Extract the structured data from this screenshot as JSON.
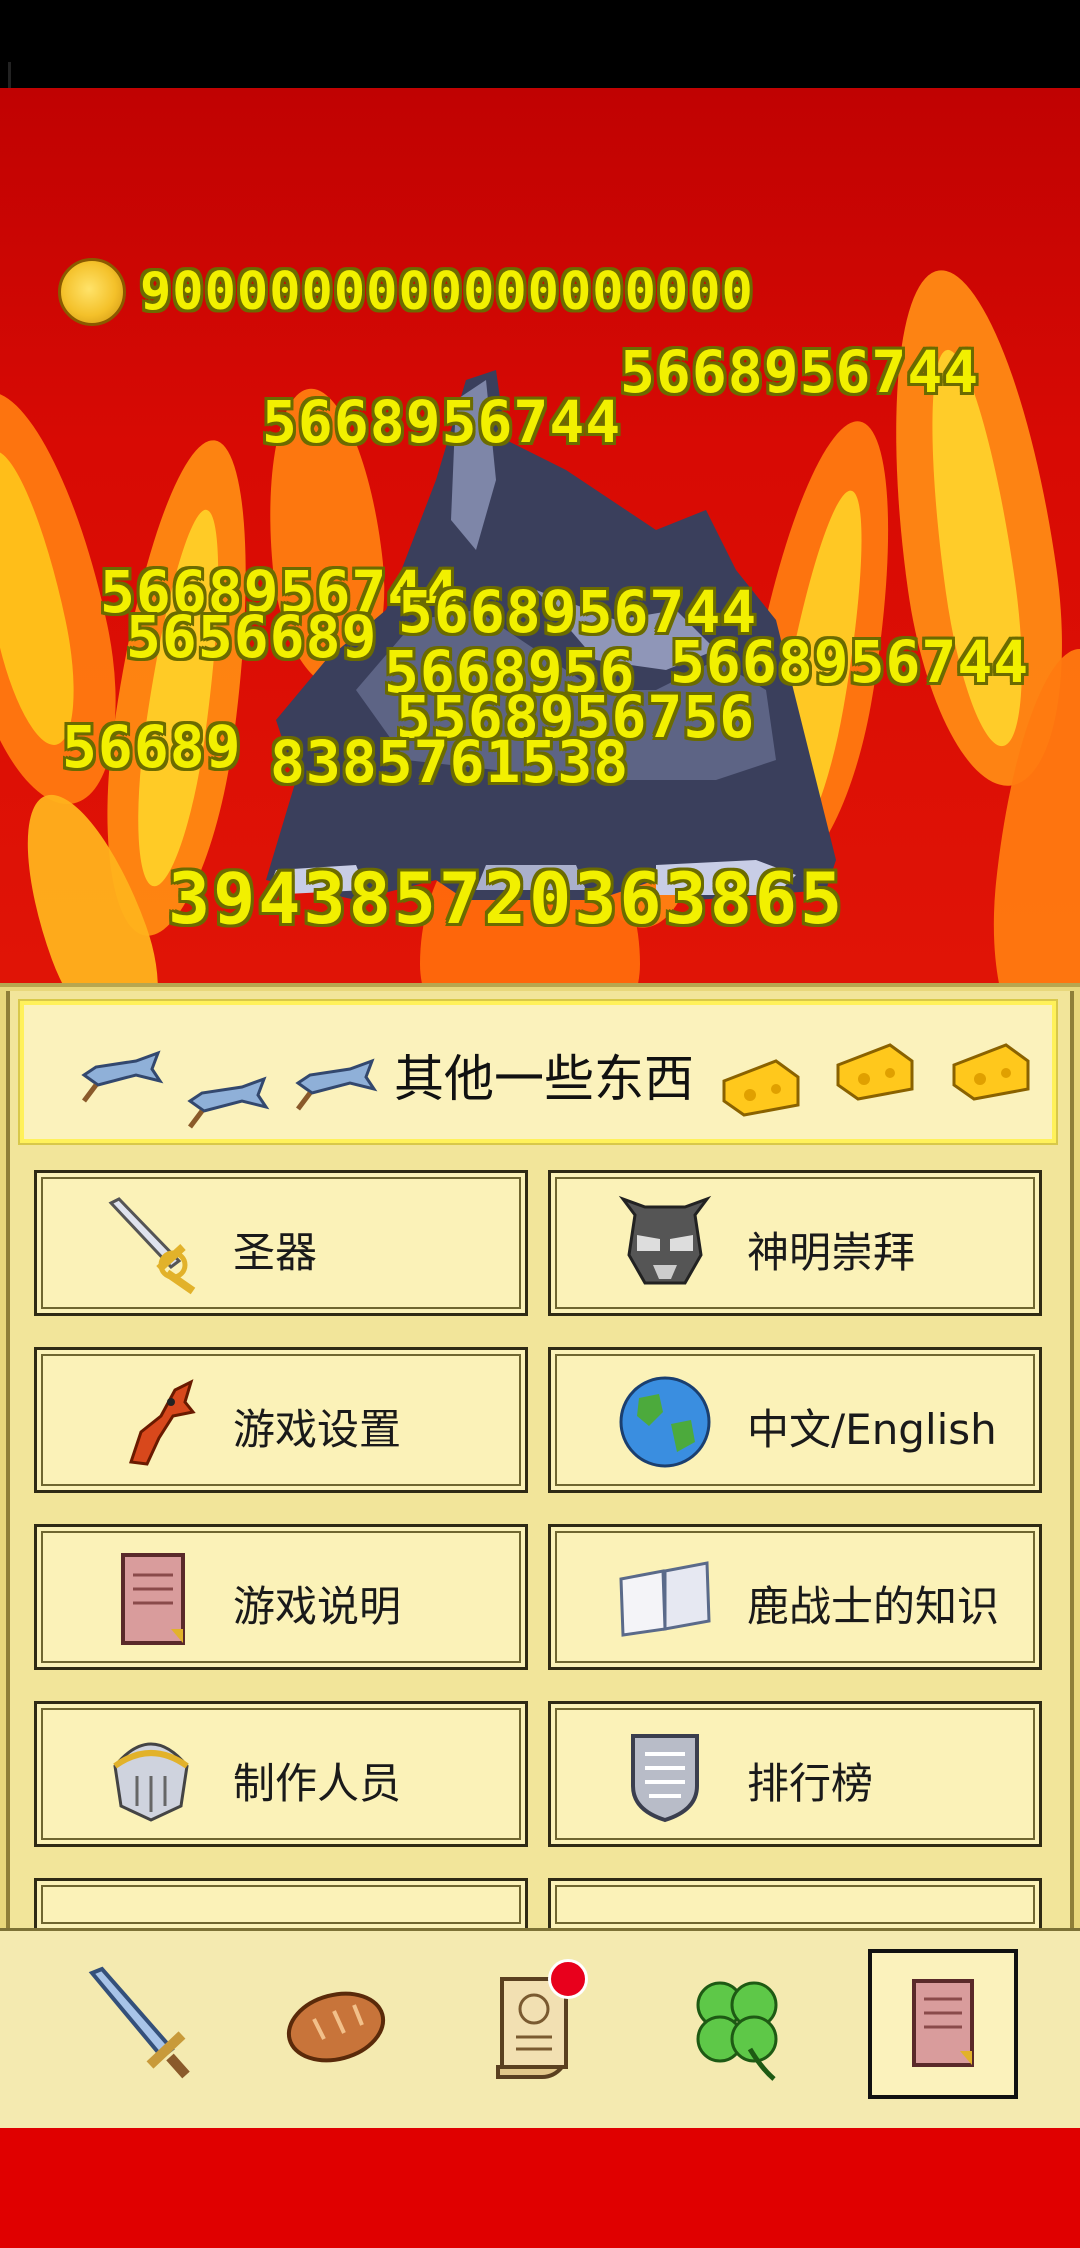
{
  "battle": {
    "gold_amount": "9000000000000000000",
    "damage_numbers": [
      "5668956744",
      "5668956744",
      "5668956744",
      "5656689",
      "5668956744",
      "5668956",
      "5668956744",
      "5568956756",
      "56689",
      "8385761538"
    ],
    "big_damage": "394385720363865"
  },
  "menu": {
    "title": "其他一些东西",
    "buttons": [
      {
        "label": "圣器",
        "icon": "holy-sword-icon"
      },
      {
        "label": "神明崇拜",
        "icon": "god-mask-icon"
      },
      {
        "label": "游戏设置",
        "icon": "lobster-icon"
      },
      {
        "label": "中文/English",
        "icon": "globe-icon"
      },
      {
        "label": "游戏说明",
        "icon": "rule-book-icon"
      },
      {
        "label": "鹿战士的知识",
        "icon": "open-book-icon"
      },
      {
        "label": "制作人员",
        "icon": "knight-helmet-icon"
      },
      {
        "label": "排行榜",
        "icon": "shield-icon"
      }
    ]
  },
  "bottom_nav": {
    "items": [
      {
        "icon": "sword-icon",
        "active": false,
        "badge": false
      },
      {
        "icon": "bread-icon",
        "active": false,
        "badge": false
      },
      {
        "icon": "scroll-icon",
        "active": false,
        "badge": true
      },
      {
        "icon": "clover-icon",
        "active": false,
        "badge": false
      },
      {
        "icon": "book-icon",
        "active": true,
        "badge": false
      }
    ]
  },
  "colors": {
    "arena_red": "#d80a04",
    "damage_yellow": "#f2f000",
    "panel_cream": "#fbf2b8",
    "badge_red": "#e8001c"
  }
}
